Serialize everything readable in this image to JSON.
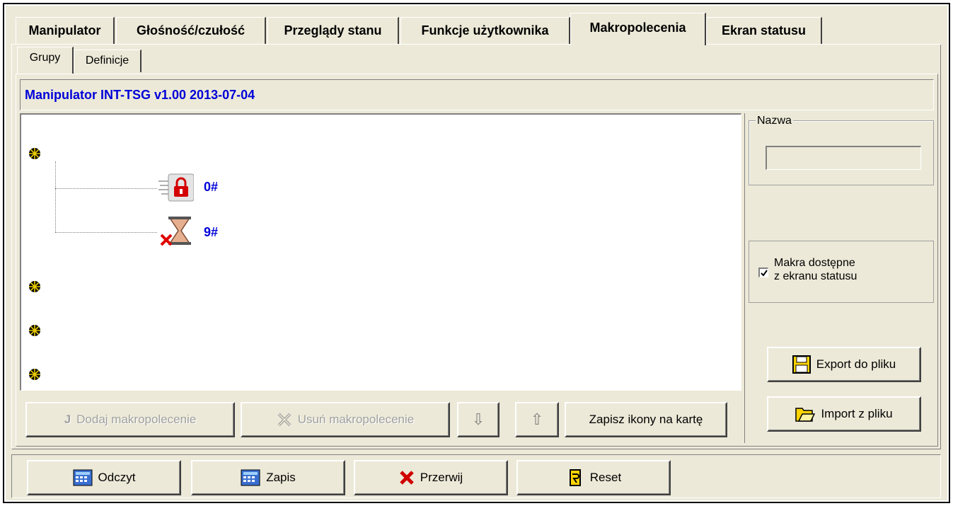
{
  "tabs": [
    "Manipulator",
    "Głośność/czułość",
    "Przeglądy stanu",
    "Funkcje użytkownika",
    "Makropolecenia",
    "Ekran statusu"
  ],
  "active_tab": "Makropolecenia",
  "subtabs": [
    "Grupy",
    "Definicje"
  ],
  "active_subtab": "Grupy",
  "device_title": "Manipulator INT-TSG v1.00 2013-07-04",
  "tree": {
    "items": [
      {
        "label": "0#",
        "icon": "arm-lock-icon"
      },
      {
        "label": "9#",
        "icon": "timer-cancel-icon"
      }
    ]
  },
  "side_panel": {
    "name_group_label": "Nazwa",
    "name_value": "",
    "checkbox_label_line1": "Makra dostępne",
    "checkbox_label_line2": "z ekranu statusu",
    "checkbox_checked": true,
    "export_label": "Export do pliku",
    "import_label": "Import z pliku"
  },
  "action_buttons": {
    "add": "Dodaj makropolecenie",
    "remove": "Usuń makropolecenie",
    "save_icons": "Zapisz ikony na kartę"
  },
  "bottom_buttons": {
    "read": "Odczyt",
    "write": "Zapis",
    "abort": "Przerwij",
    "reset": "Reset"
  },
  "colors": {
    "title_blue": "#0000d8",
    "window_bg": "#ece9d8"
  }
}
